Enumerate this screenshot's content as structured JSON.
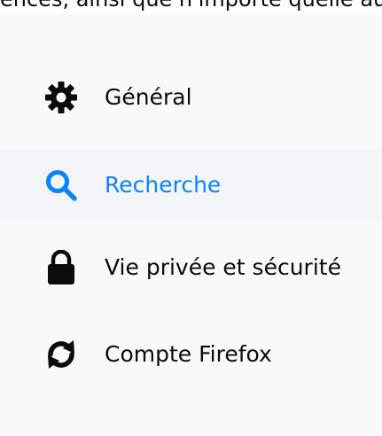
{
  "header": {
    "partial_text": "ences, ainsi que n'importe quelle autre"
  },
  "sidebar": {
    "items": [
      {
        "label": "Général",
        "icon": "gear-icon",
        "selected": false
      },
      {
        "label": "Recherche",
        "icon": "search-icon",
        "selected": true
      },
      {
        "label": "Vie privée et sécurité",
        "icon": "lock-icon",
        "selected": false
      },
      {
        "label": "Compte Firefox",
        "icon": "sync-icon",
        "selected": false
      }
    ]
  },
  "colors": {
    "accent": "#0a84ff",
    "text": "#0c0c0d",
    "background": "#f9f9fb"
  }
}
